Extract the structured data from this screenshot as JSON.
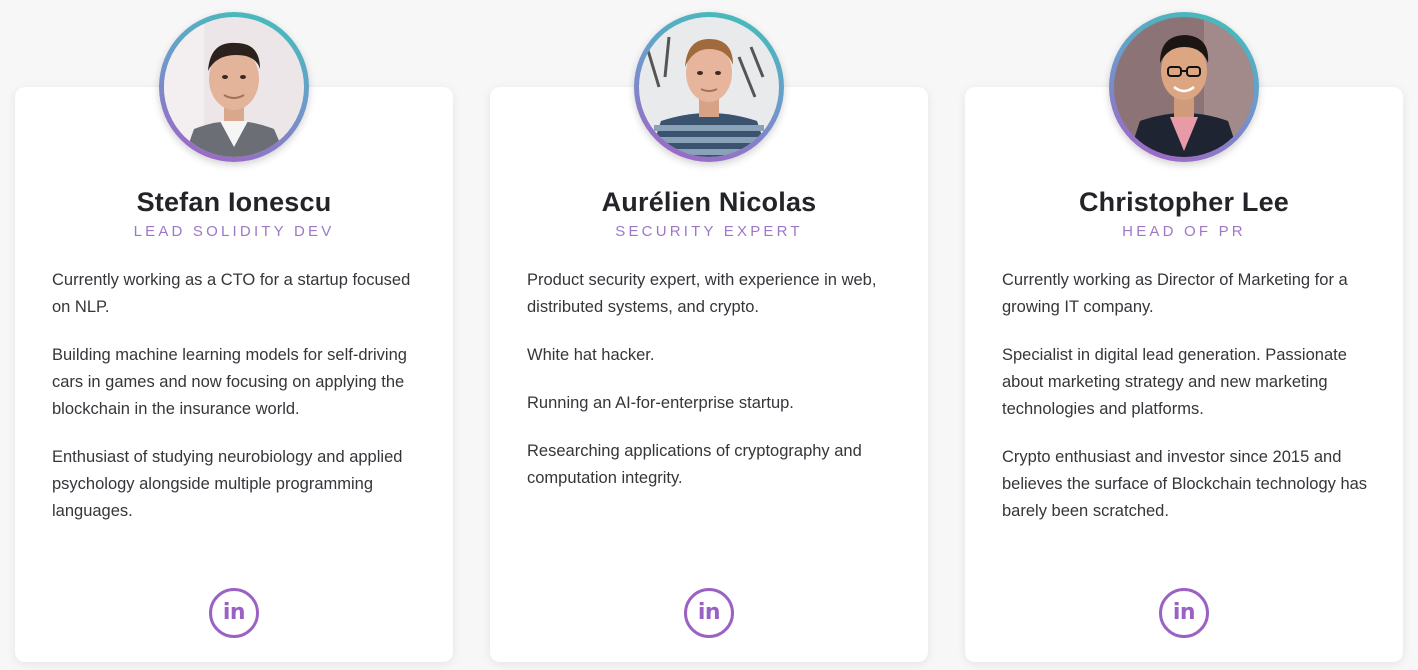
{
  "team": {
    "members": [
      {
        "name": "Stefan Ionescu",
        "role": "LEAD SOLIDITY DEV",
        "bio": [
          "Currently working as a CTO for a startup focused on NLP.",
          "Building machine learning models for self-driving cars in games and now focusing on applying the blockchain in the insurance world.",
          "Enthusiast of studying neurobiology and applied psychology alongside multiple programming languages."
        ],
        "linkedin_label": "in",
        "avatar_icon": "portrait-photo"
      },
      {
        "name": "Aurélien Nicolas",
        "role": "SECURITY EXPERT",
        "bio": [
          "Product security expert, with experience in web, distributed systems, and crypto.",
          "White hat hacker.",
          "Running an AI-for-enterprise startup.",
          "Researching applications of cryptography and computation integrity."
        ],
        "linkedin_label": "in",
        "avatar_icon": "portrait-photo"
      },
      {
        "name": "Christopher Lee",
        "role": "HEAD OF PR",
        "bio": [
          "Currently working as Director of Marketing for a growing IT company.",
          "Specialist in digital lead generation. Passionate about marketing strategy and new marketing technologies and platforms.",
          "Crypto enthusiast and investor since 2015 and believes the surface of Blockchain technology has barely been scratched."
        ],
        "linkedin_label": "in",
        "avatar_icon": "portrait-photo"
      }
    ]
  },
  "colors": {
    "accent": "#9a62c4",
    "role_text": "#9d78c8",
    "ring_start": "#3cc3b5",
    "ring_end": "#a55fc4",
    "background": "#f7f7f8",
    "card": "#ffffff"
  }
}
